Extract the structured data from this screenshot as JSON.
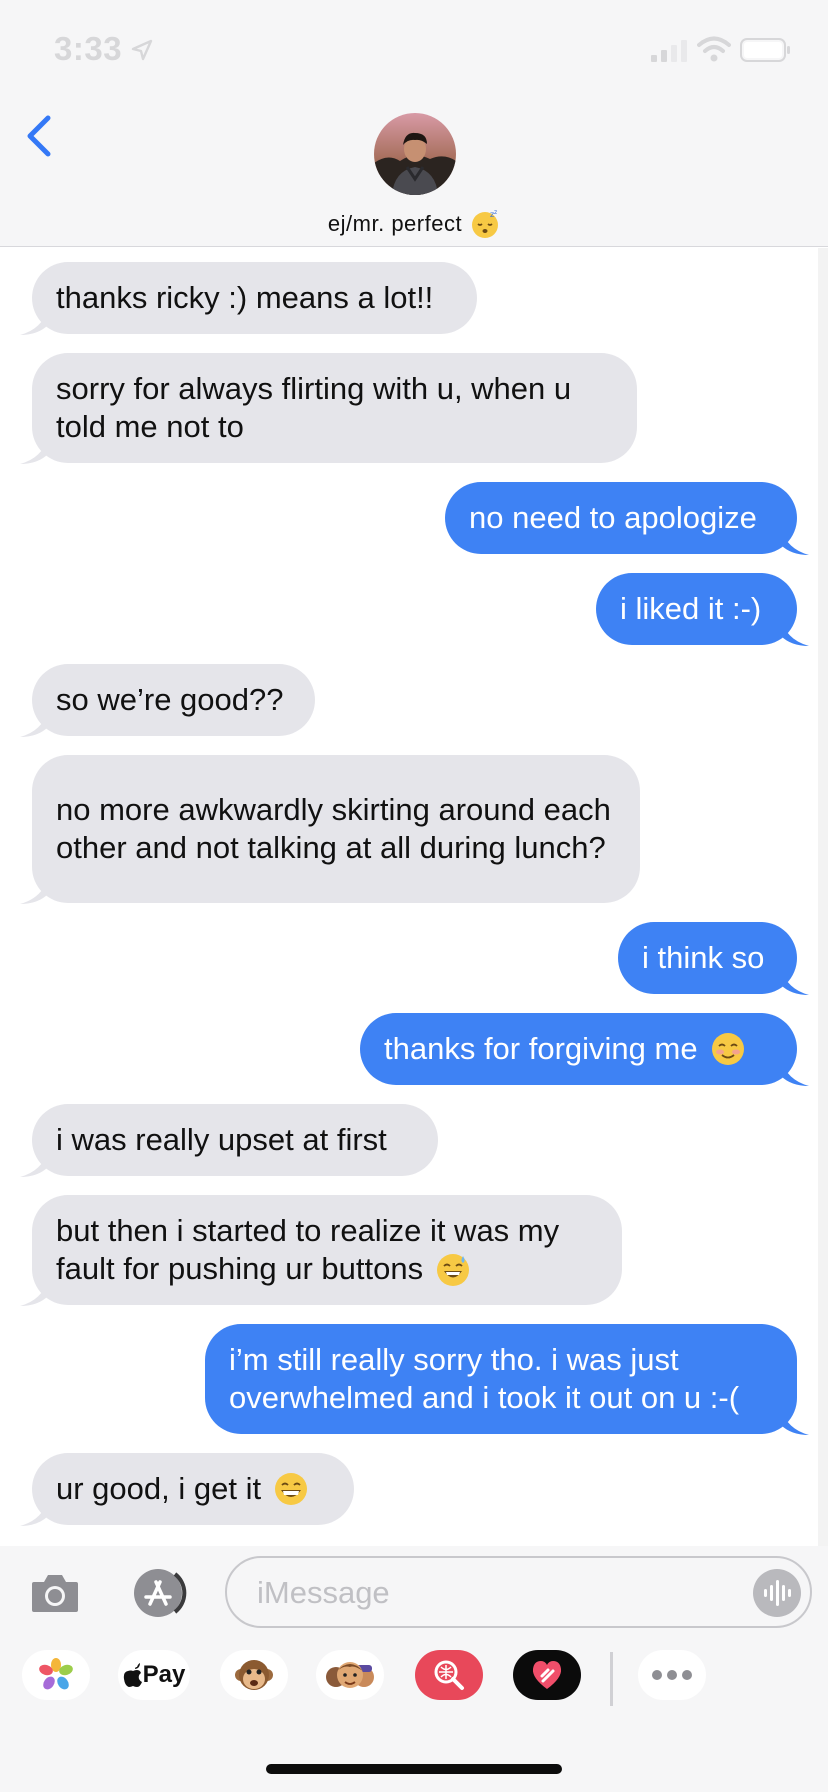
{
  "status_bar": {
    "time": "3:33",
    "icons": [
      "location-arrow-icon",
      "cellular-signal-icon",
      "wifi-icon",
      "battery-icon"
    ]
  },
  "header": {
    "back_icon": "chevron-left-icon",
    "contact_name": "ej/mr. perfect",
    "name_emoji": "sleeping-face-emoji"
  },
  "messages": [
    {
      "from": "them",
      "text": "thanks ricky :) means a lot!!"
    },
    {
      "from": "them",
      "text": "sorry for always flirting with u, when u told me not to"
    },
    {
      "from": "me",
      "text": "no need to apologize"
    },
    {
      "from": "me",
      "text": "i liked it :-)"
    },
    {
      "from": "them",
      "text": "so we’re good??"
    },
    {
      "from": "them",
      "text": "no more awkwardly skirting around each other and not talking at all during lunch?"
    },
    {
      "from": "me",
      "text": "i think so"
    },
    {
      "from": "me",
      "text": "thanks for forgiving me",
      "emoji": "smiling-face-emoji"
    },
    {
      "from": "them",
      "text": "i was really upset at first"
    },
    {
      "from": "them",
      "text": "but then i started to realize it was my fault for pushing ur buttons",
      "emoji": "grinning-sweat-emoji"
    },
    {
      "from": "me",
      "text": "i’m still really sorry tho. i was just overwhelmed and i took it out on u :-("
    },
    {
      "from": "them",
      "text": "ur good, i get it",
      "emoji": "grinning-emoji"
    }
  ],
  "input_bar": {
    "placeholder": "iMessage",
    "camera_icon": "camera-icon",
    "appstore_icon": "app-store-icon",
    "audio_icon": "audio-waveform-icon"
  },
  "app_drawer": {
    "apple_pay_label": "Pay",
    "apps": [
      "photos-icon",
      "apple-pay-icon",
      "animoji-icon",
      "memoji-icon",
      "image-search-icon",
      "digital-touch-icon",
      "more-icon"
    ]
  },
  "colors": {
    "outgoing_bubble": "#3e82f4",
    "incoming_bubble": "#e5e5ea",
    "accent": "#3478f6"
  }
}
